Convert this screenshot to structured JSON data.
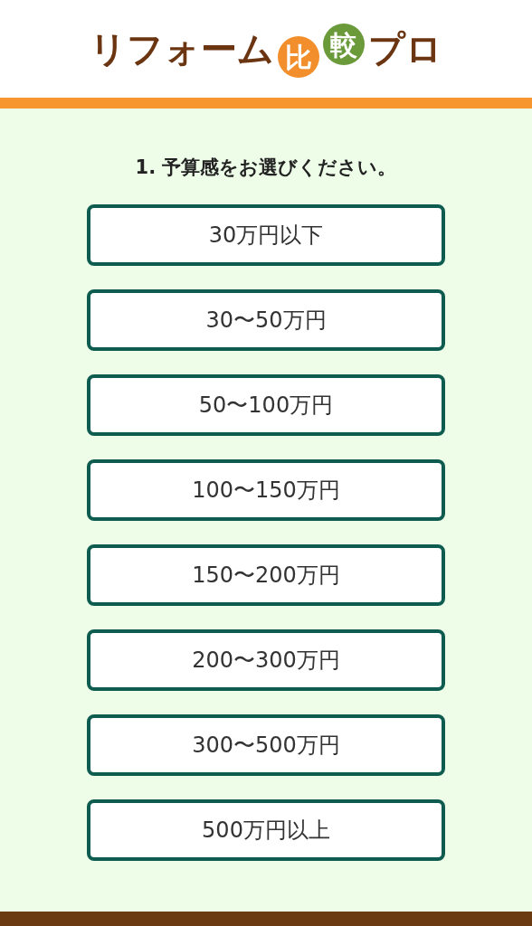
{
  "logo": {
    "parts": [
      {
        "kind": "plain",
        "text": "リフォーム"
      },
      {
        "kind": "circle",
        "text": "比",
        "color": "#f28f2c"
      },
      {
        "kind": "circle",
        "text": "較",
        "color": "#6a9a3a"
      },
      {
        "kind": "plain",
        "text": "プロ"
      }
    ]
  },
  "question": "1. 予算感をお選びください。",
  "options": [
    "30万円以下",
    "30〜50万円",
    "50〜100万円",
    "100〜150万円",
    "150〜200万円",
    "200〜300万円",
    "300〜500万円",
    "500万円以上"
  ]
}
